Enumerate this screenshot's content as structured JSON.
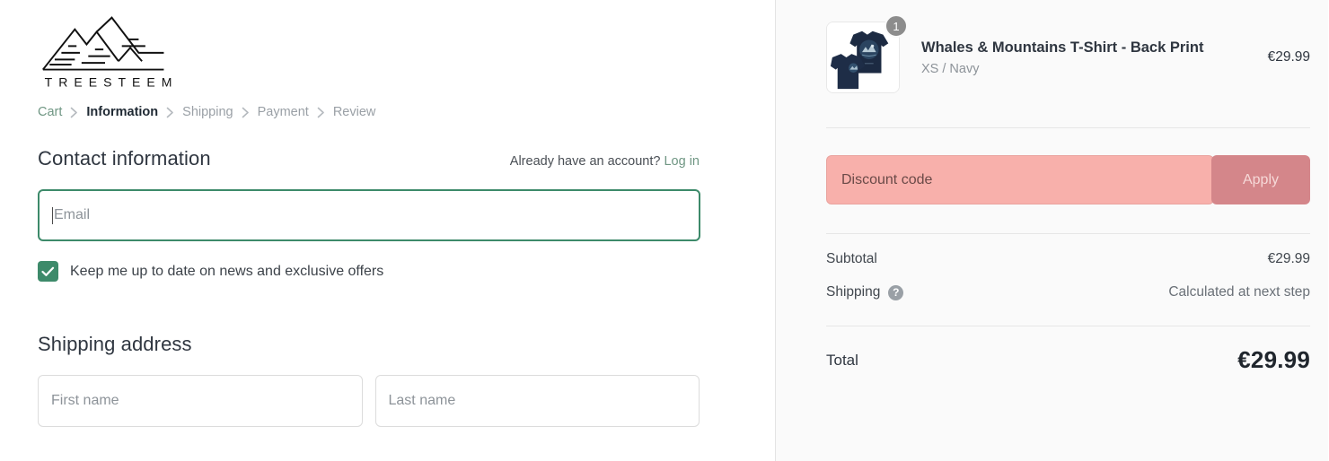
{
  "brand": {
    "name": "TREESTEEM",
    "logo_icon": "mountains-logo"
  },
  "breadcrumb": {
    "items": [
      {
        "label": "Cart",
        "state": "link"
      },
      {
        "label": "Information",
        "state": "current"
      },
      {
        "label": "Shipping",
        "state": "upcoming"
      },
      {
        "label": "Payment",
        "state": "upcoming"
      },
      {
        "label": "Review",
        "state": "upcoming"
      }
    ]
  },
  "contact": {
    "heading": "Contact information",
    "account_prompt": "Already have an account?",
    "login_label": "Log in",
    "email_placeholder": "Email",
    "email_value": "",
    "newsletter_label": "Keep me up to date on news and exclusive offers",
    "newsletter_checked": true
  },
  "shipping_address": {
    "heading": "Shipping address",
    "first_name_placeholder": "First name",
    "first_name_value": "",
    "last_name_placeholder": "Last name",
    "last_name_value": ""
  },
  "order_summary": {
    "item": {
      "name": "Whales & Mountains T-Shirt - Back Print",
      "variant": "XS / Navy",
      "quantity": "1",
      "price": "€29.99",
      "image_icon": "navy-tshirt-thumbnail"
    },
    "discount": {
      "placeholder": "Discount code",
      "value": "",
      "apply_label": "Apply"
    },
    "subtotal_label": "Subtotal",
    "subtotal_value": "€29.99",
    "shipping_label": "Shipping",
    "shipping_help_icon": "question-mark-icon",
    "shipping_value": "Calculated at next step",
    "total_label": "Total",
    "total_value": "€29.99"
  },
  "colors": {
    "accent_green": "#3d8a6a",
    "link_green": "#6f9683",
    "discount_bg": "#f8b0ab",
    "apply_bg": "#d4868a",
    "panel_bg": "#fafafa",
    "text_dark": "#2f3640",
    "text_muted": "#8d9399"
  }
}
